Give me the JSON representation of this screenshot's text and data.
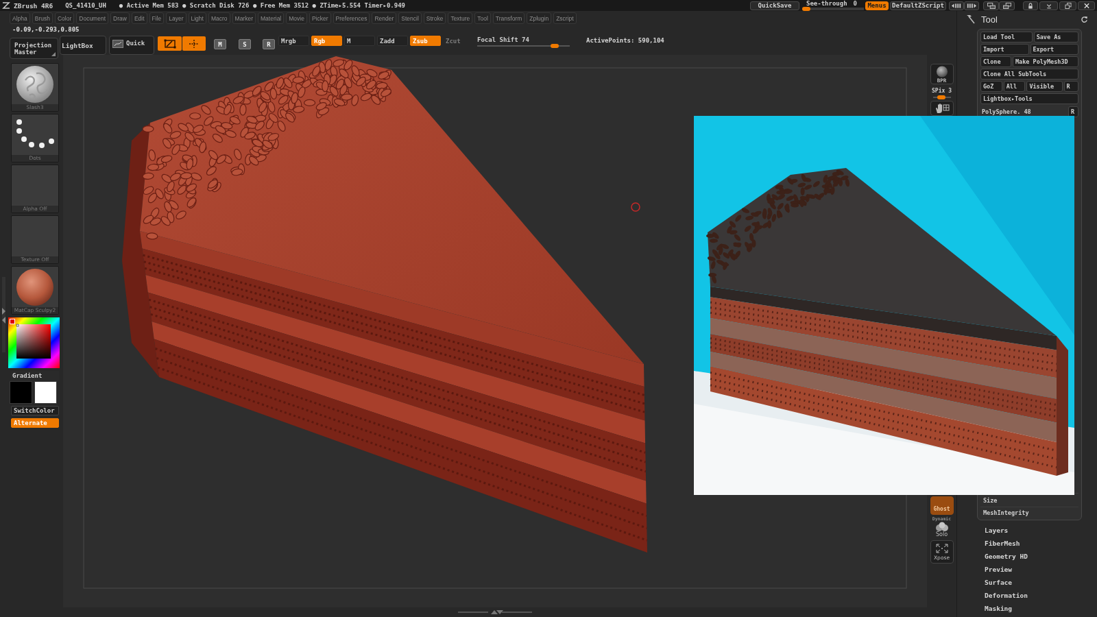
{
  "title_bar": {
    "app_name": "ZBrush 4R6",
    "file_name": "QS_41410_UH",
    "status": "● Active Mem 583 ● Scratch Disk 726 ● Free Mem 3512 ● ZTime▸5.554 Timer▸0.949",
    "quicksave": "QuickSave",
    "see_through": {
      "label": "See-through",
      "value": "0",
      "level": 0
    },
    "menus": {
      "label": "Menus",
      "on": true
    },
    "script": "DefaultZScript"
  },
  "menu_bar": [
    "Alpha",
    "Brush",
    "Color",
    "Document",
    "Draw",
    "Edit",
    "File",
    "Layer",
    "Light",
    "Macro",
    "Marker",
    "Material",
    "Movie",
    "Picker",
    "Preferences",
    "Render",
    "Stencil",
    "Stroke",
    "Texture",
    "Tool",
    "Transform",
    "Zplugin",
    "Zscript"
  ],
  "coordinates": "-0.09,-0.293,0.805",
  "top_shelf": {
    "projection_master": "Projection Master",
    "lightbox": "LightBox",
    "quick_sketch": "Quick",
    "transform_tools": [
      {
        "kind": "edit",
        "selected": true
      },
      {
        "kind": "draw",
        "selected": true
      },
      {
        "kind": "move",
        "letter": "M",
        "selected": false
      },
      {
        "kind": "scale",
        "letter": "S",
        "selected": false
      },
      {
        "kind": "rotate",
        "letter": "R",
        "selected": false
      }
    ],
    "modes": [
      {
        "label": "Mrgb",
        "on": false,
        "disabled": false
      },
      {
        "label": "Rgb",
        "on": true,
        "disabled": false
      },
      {
        "label": "M",
        "on": false,
        "disabled": false
      },
      {
        "label": "Zadd",
        "on": false,
        "disabled": false
      },
      {
        "label": "Zsub",
        "on": true,
        "disabled": false
      },
      {
        "label": "Zcut",
        "on": false,
        "disabled": true
      }
    ],
    "focal_shift": {
      "label": "Focal Shift 74",
      "level": 0.87
    },
    "active_points": "ActivePoints: 590,104"
  },
  "left_shelf": {
    "tiles": [
      {
        "kind": "brush",
        "label": "Slash3"
      },
      {
        "kind": "stroke",
        "label": "Dots"
      },
      {
        "kind": "alpha",
        "label": "Alpha Off"
      },
      {
        "kind": "texture",
        "label": "Texture Off"
      },
      {
        "kind": "material",
        "label": "MatCap Sculpy2"
      }
    ],
    "gradient": "Gradient",
    "swatches": [
      {
        "color": "#000000"
      },
      {
        "color": "#ffffff"
      }
    ],
    "switch_color": "SwitchColor",
    "alternate": {
      "label": "Alternate",
      "on": true
    }
  },
  "right_shelf": {
    "bpr": "BPR",
    "spix": {
      "label": "SPix 3",
      "level": 0.43
    },
    "ghost": {
      "label": "Ghost",
      "on": true
    },
    "dynamic": "Dynamic",
    "solo": "Solo",
    "xpose": "Xpose"
  },
  "tool_palette": {
    "title": "Tool",
    "button_rows": [
      [
        "Load Tool",
        "Save As"
      ],
      [
        "Import",
        "Export"
      ],
      [
        "Clone",
        "Make PolyMesh3D"
      ],
      [
        "Clone All SubTools"
      ],
      [
        "GoZ",
        "All",
        "Visible",
        "R"
      ],
      [
        "Lightbox▸Tools"
      ]
    ],
    "current_tool": {
      "name": "PolySphere. 48",
      "button": "R"
    },
    "settings": [
      "Size",
      "MeshIntegrity"
    ],
    "subpalettes": [
      "Layers",
      "FiberMesh",
      "Geometry HD",
      "Preview",
      "Surface",
      "Deformation",
      "Masking"
    ]
  }
}
